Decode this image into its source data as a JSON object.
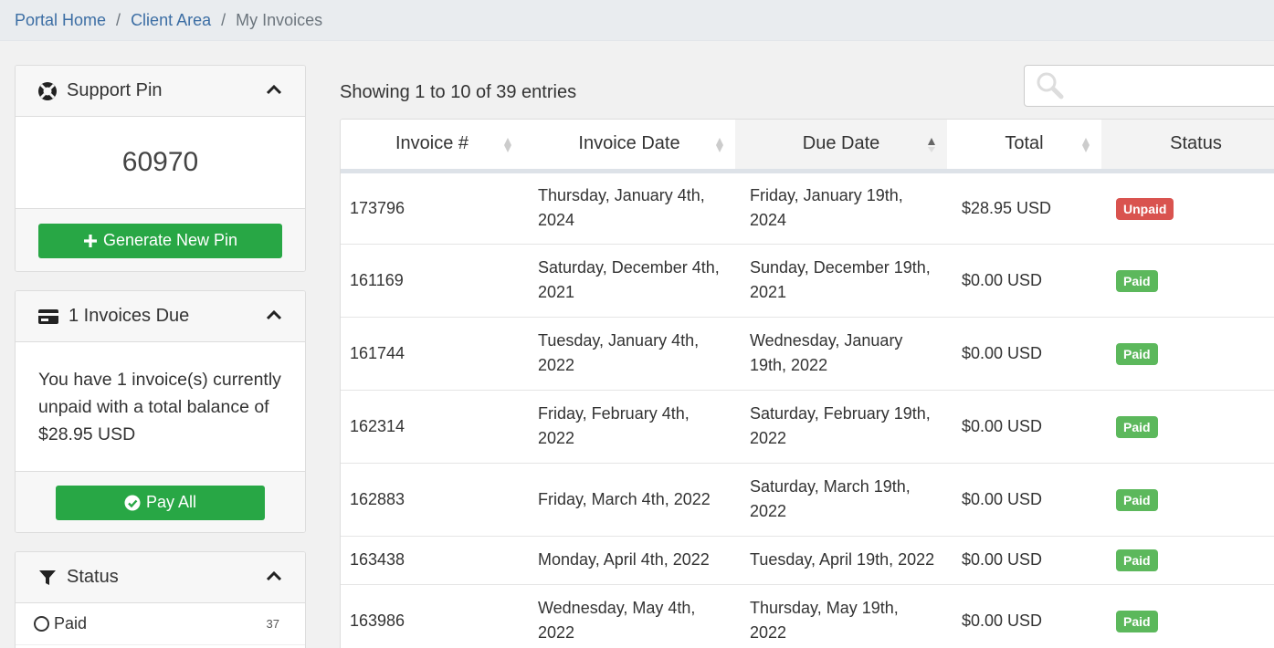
{
  "breadcrumb": {
    "items": [
      "Portal Home",
      "Client Area"
    ],
    "separator": "/",
    "active": "My Invoices"
  },
  "support_pin": {
    "title": "Support Pin",
    "pin": "60970",
    "generate_label": "Generate New Pin"
  },
  "invoices_due": {
    "title": "1 Invoices Due",
    "message": "You have 1 invoice(s) currently unpaid with a total balance of $28.95 USD",
    "pay_all_label": "Pay All"
  },
  "status_filter": {
    "title": "Status",
    "items": [
      {
        "label": "Paid",
        "count": "37"
      }
    ]
  },
  "table": {
    "showing": "Showing 1 to 10 of 39 entries",
    "search": {
      "placeholder": "",
      "value": ""
    },
    "columns": [
      "Invoice #",
      "Invoice Date",
      "Due Date",
      "Total",
      "Status"
    ],
    "rows": [
      {
        "id": "173796",
        "date": "Thursday, January 4th, 2024",
        "due": "Friday, January 19th, 2024",
        "total": "$28.95 USD",
        "status": "Unpaid"
      },
      {
        "id": "161169",
        "date": "Saturday, December 4th, 2021",
        "due": "Sunday, December 19th, 2021",
        "total": "$0.00 USD",
        "status": "Paid"
      },
      {
        "id": "161744",
        "date": "Tuesday, January 4th, 2022",
        "due": "Wednesday, January 19th, 2022",
        "total": "$0.00 USD",
        "status": "Paid"
      },
      {
        "id": "162314",
        "date": "Friday, February 4th, 2022",
        "due": "Saturday, February 19th, 2022",
        "total": "$0.00 USD",
        "status": "Paid"
      },
      {
        "id": "162883",
        "date": "Friday, March 4th, 2022",
        "due": "Saturday, March 19th, 2022",
        "total": "$0.00 USD",
        "status": "Paid"
      },
      {
        "id": "163438",
        "date": "Monday, April 4th, 2022",
        "due": "Tuesday, April 19th, 2022",
        "total": "$0.00 USD",
        "status": "Paid"
      },
      {
        "id": "163986",
        "date": "Wednesday, May 4th, 2022",
        "due": "Thursday, May 19th, 2022",
        "total": "$0.00 USD",
        "status": "Paid"
      }
    ]
  },
  "colors": {
    "link": "#3c6ea4",
    "green_button": "#28a745",
    "badge_unpaid": "#d9534f",
    "badge_paid": "#5cb85c"
  },
  "icons": {
    "support": "lifebuoy-icon",
    "invoices": "credit-card-icon",
    "status": "filter-icon",
    "collapse": "chevron-up-icon",
    "generate": "plus-icon",
    "pay": "check-circle-icon",
    "search": "search-icon"
  }
}
